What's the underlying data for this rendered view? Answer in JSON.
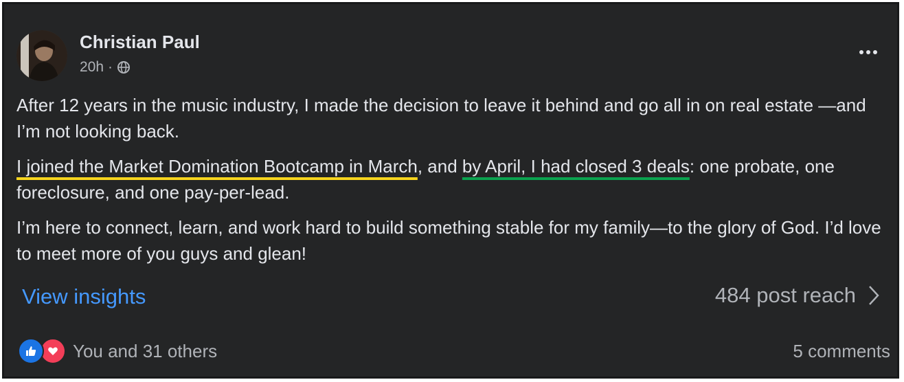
{
  "post": {
    "author": "Christian Paul",
    "time": "20h",
    "separator": "·",
    "audience_icon": "globe-icon",
    "more_icon": "more-options-icon",
    "paragraphs": {
      "p1": "After 12 years in the music industry, I made the decision to leave it behind and go all in on real estate —and I’m not looking back.",
      "p2_highlight_yellow": "I joined the Market Domination Bootcamp in March",
      "p2_mid": ", and ",
      "p2_highlight_green": "by April, I had closed 3 deals",
      "p2_end": ": one probate, one foreclosure, and one pay-per-lead.",
      "p3": "I’m here to connect, learn, and work hard to build something stable for my family—to the glory of God. I’d love to meet more of you guys and glean!"
    },
    "insights_label": "View insights",
    "reach_label": "484 post reach",
    "reactions_text": "You and 31 others",
    "comments_label": "5 comments"
  },
  "colors": {
    "background": "#242526",
    "link": "#4599ff",
    "highlight_yellow": "#f7d51d",
    "highlight_green": "#0aa34f",
    "like": "#1b74e4",
    "love": "#f33e58"
  }
}
